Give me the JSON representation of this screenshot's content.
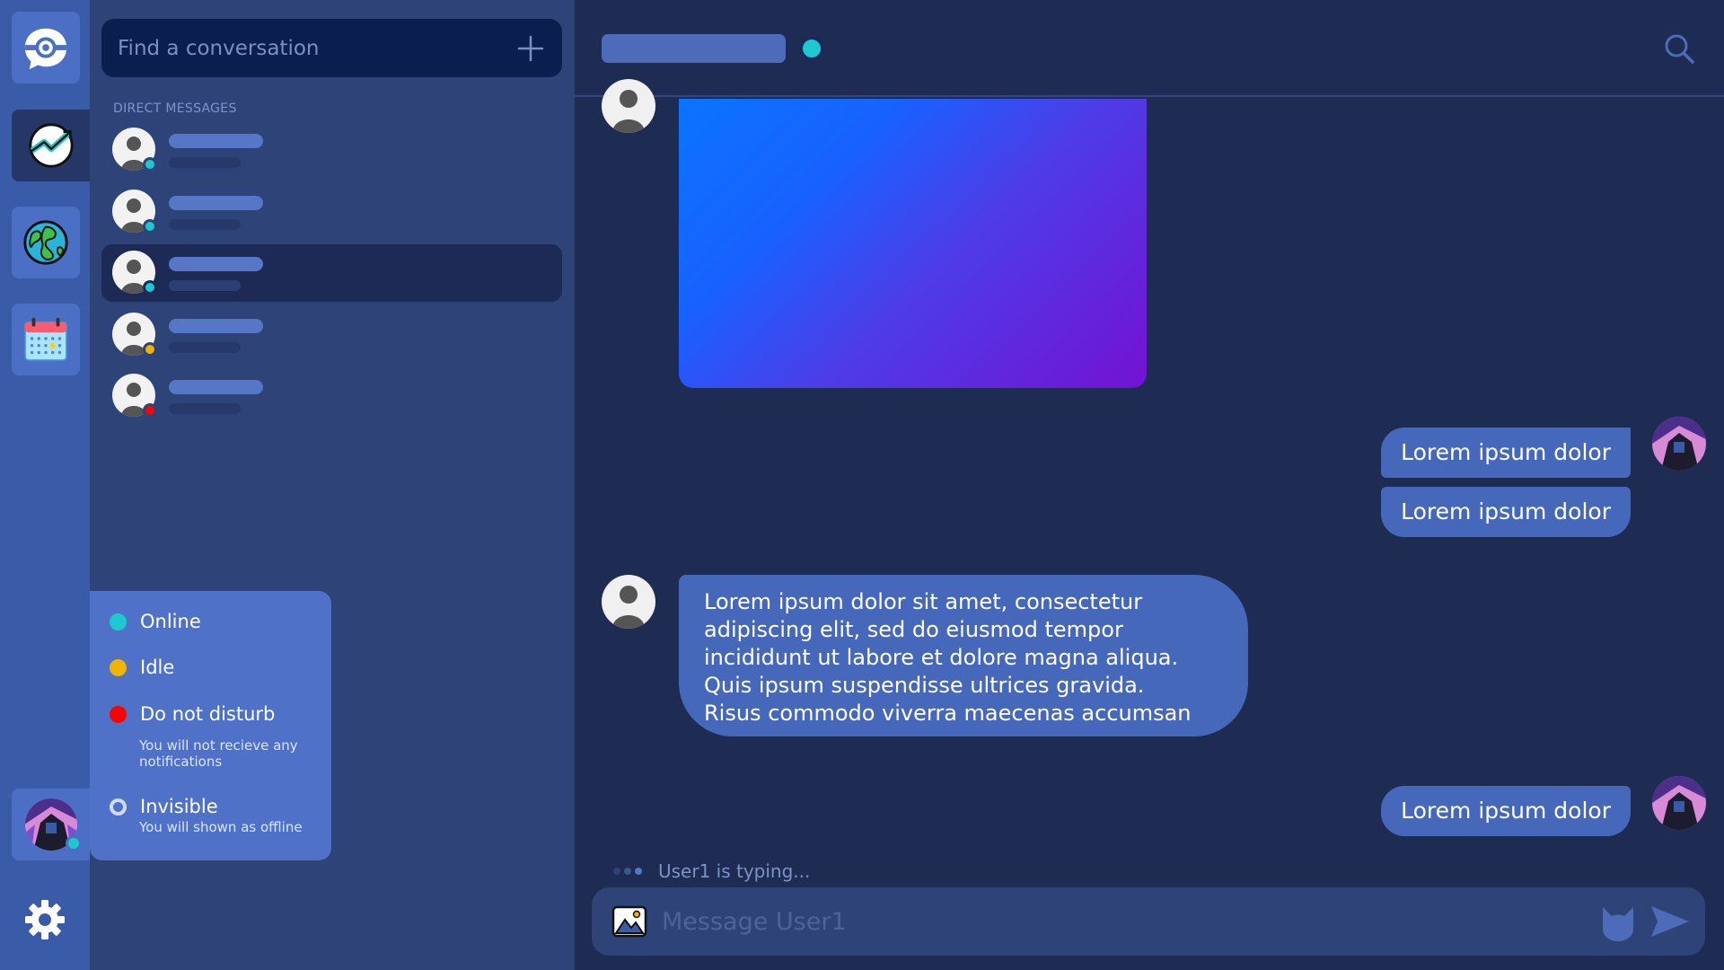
{
  "sidebar": {
    "servers": [
      {
        "icon": "chat-logo-icon"
      },
      {
        "icon": "activity-icon",
        "active": true
      },
      {
        "icon": "globe-icon"
      },
      {
        "icon": "calendar-icon"
      }
    ],
    "settings_icon": "gear-icon"
  },
  "dm_panel": {
    "search_placeholder": "Find a conversation",
    "heading": "DIRECT MESSAGES",
    "conversations": [
      {
        "status": "online"
      },
      {
        "status": "online"
      },
      {
        "status": "online",
        "selected": true
      },
      {
        "status": "idle"
      },
      {
        "status": "dnd"
      }
    ]
  },
  "status_menu": {
    "options": [
      {
        "label": "Online",
        "color": "#1ec8d0"
      },
      {
        "label": "Idle",
        "color": "#f0b400"
      },
      {
        "label": "Do not disturb",
        "color": "#ff0000",
        "description": "You will not recieve any notifications"
      },
      {
        "label": "Invisible",
        "description": "You will shown as offline"
      }
    ]
  },
  "chat": {
    "header_status_color": "#1ec8d0",
    "messages": {
      "out1": "Lorem ipsum dolor",
      "out2": "Lorem ipsum dolor",
      "in1": "Lorem ipsum dolor sit amet, consectetur\nadipiscing elit, sed do eiusmod tempor\nincididunt ut labore et dolore magna aliqua.\nQuis ipsum suspendisse ultrices gravida.\nRisus commodo viverra maecenas accumsan",
      "out3": "Lorem ipsum dolor"
    },
    "typing": "User1 is typing...",
    "composer_placeholder": "Message User1"
  },
  "colors": {
    "online": "#1ec8d0",
    "idle": "#f0b400",
    "dnd": "#ff0000",
    "accent": "#4668bb"
  }
}
